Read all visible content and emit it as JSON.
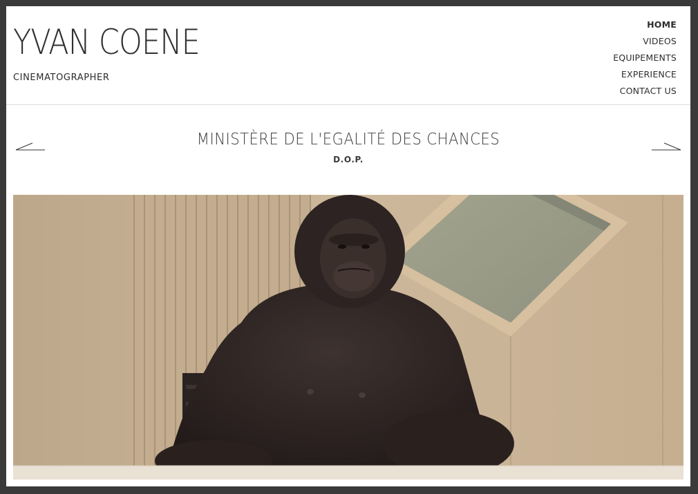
{
  "site": {
    "title": "YVAN COENE",
    "tagline": "CINEMATOGRAPHER"
  },
  "nav": {
    "items": [
      {
        "label": "HOME",
        "active": true
      },
      {
        "label": "VIDEOS",
        "active": false
      },
      {
        "label": "EQUIPEMENTS",
        "active": false
      },
      {
        "label": "EXPERIENCE",
        "active": false
      },
      {
        "label": "CONTACT US",
        "active": false
      }
    ]
  },
  "project": {
    "title": "MINISTÈRE DE L'EGALITÉ DES CHANCES",
    "role": "D.O.P."
  },
  "icons": {
    "prev": "arrow-left-icon",
    "next": "arrow-right-icon"
  },
  "hero_image": {
    "subject": "chimpanzee-at-desk-still"
  },
  "colors": {
    "frame": "#3a3a3a",
    "text": "#2f2f2f",
    "background": "#ffffff"
  }
}
